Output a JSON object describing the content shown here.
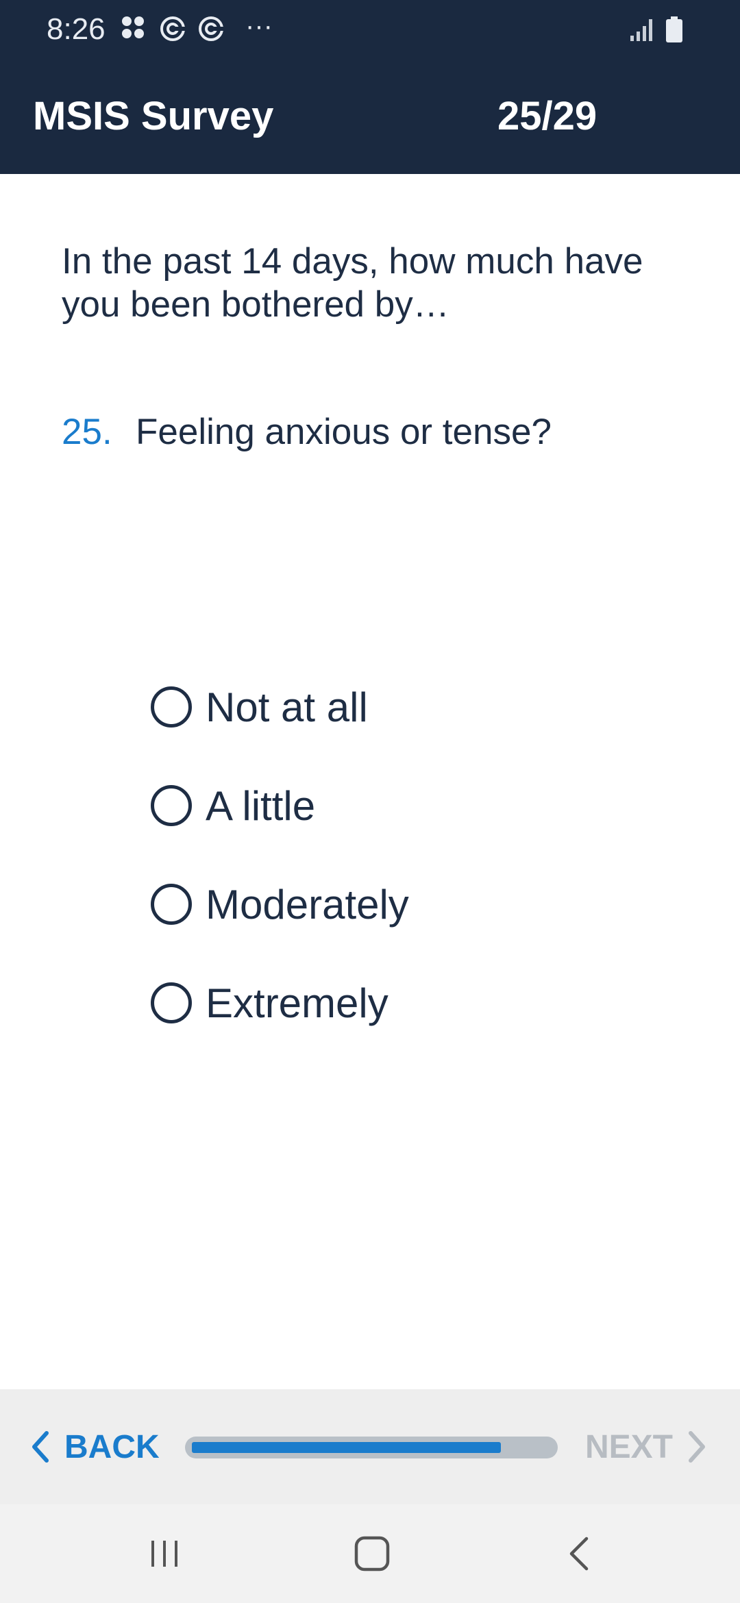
{
  "status_bar": {
    "time": "8:26",
    "notification_icons": [
      "apps-icon",
      "sync-icon",
      "sync-icon",
      "more-dots-icon"
    ],
    "more_dots": "···"
  },
  "header": {
    "title": "MSIS Survey",
    "counter": "25/29"
  },
  "intro_text": "In the past 14 days, how much have you been bothered by…",
  "question": {
    "number": "25.",
    "text": "Feeling anxious or tense?"
  },
  "options": [
    {
      "label": "Not at all",
      "selected": false
    },
    {
      "label": "A little",
      "selected": false
    },
    {
      "label": "Moderately",
      "selected": false
    },
    {
      "label": "Extremely",
      "selected": false
    }
  ],
  "footer": {
    "back_label": "BACK",
    "next_label": "NEXT",
    "progress_fraction": 0.86
  },
  "colors": {
    "header_bg": "#1a2940",
    "accent": "#1a7ccc",
    "text": "#1e2d44",
    "disabled": "#b7bcc2"
  }
}
